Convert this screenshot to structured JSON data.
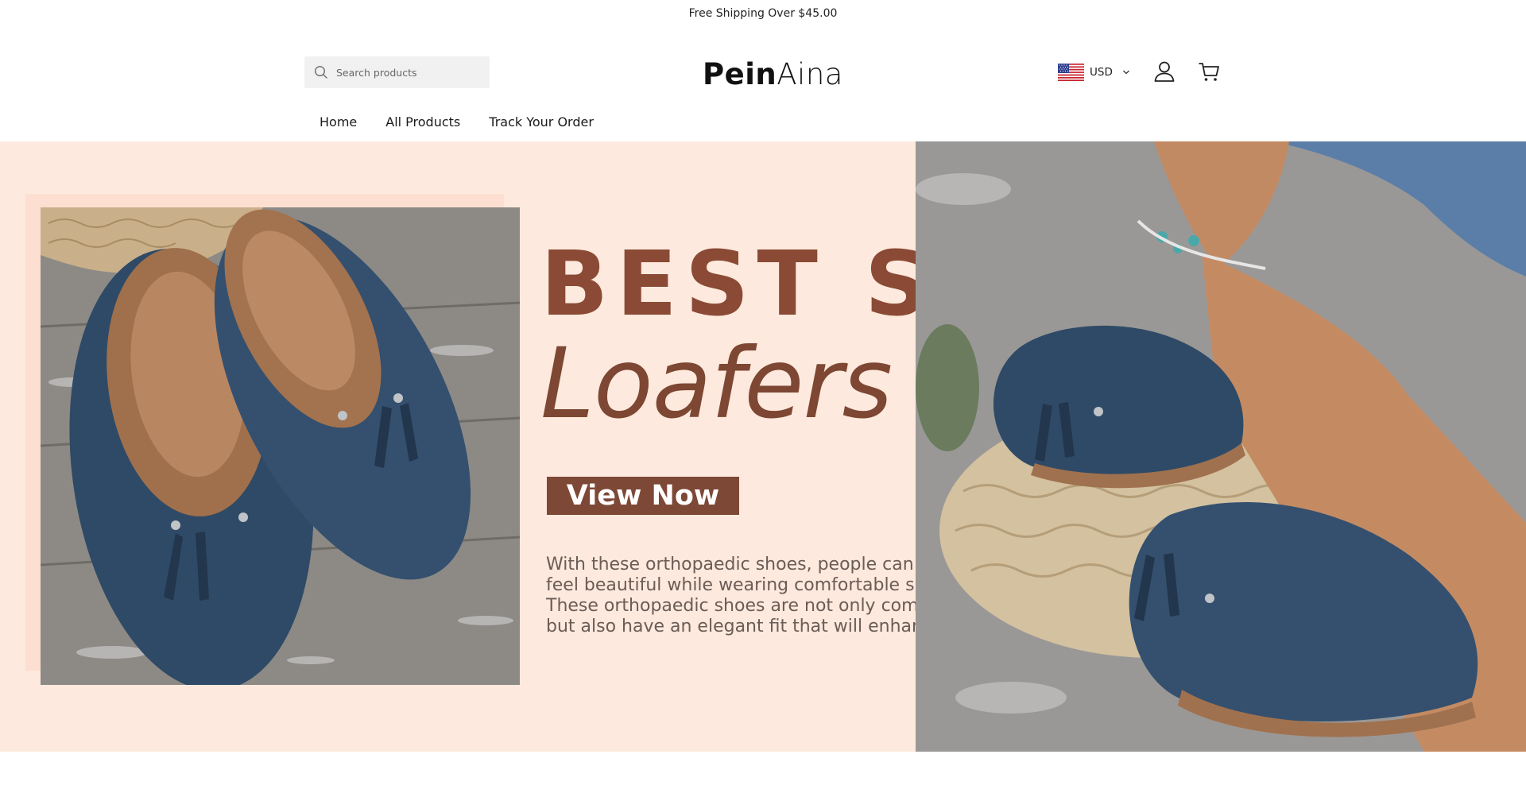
{
  "announcement": {
    "text": "Free Shipping Over $45.00"
  },
  "header": {
    "search": {
      "placeholder": "Search products",
      "icon": "search-icon"
    },
    "logo": {
      "part1": "Pein",
      "part2": "Aina"
    },
    "currency": {
      "code": "USD",
      "flag": "us-flag-icon"
    },
    "icons": [
      "user-icon",
      "cart-icon"
    ]
  },
  "nav": {
    "items": [
      {
        "label": "Home"
      },
      {
        "label": "All Products"
      },
      {
        "label": "Track Your Order"
      }
    ]
  },
  "hero": {
    "headline": "BEST SALE",
    "subline": "Loafers",
    "button_label": "View Now",
    "body_lines": [
      "With these orthopaedic shoes, people can finally",
      "feel beautiful while wearing comfortable shoes.",
      "These orthopaedic shoes are not only comfortable",
      "but also have an elegant fit that will enhance your image."
    ],
    "colors": {
      "background": "#fde9dd",
      "headline": "#8a4a35",
      "button": "#7d4836",
      "shoe": "#2f4a66"
    }
  }
}
